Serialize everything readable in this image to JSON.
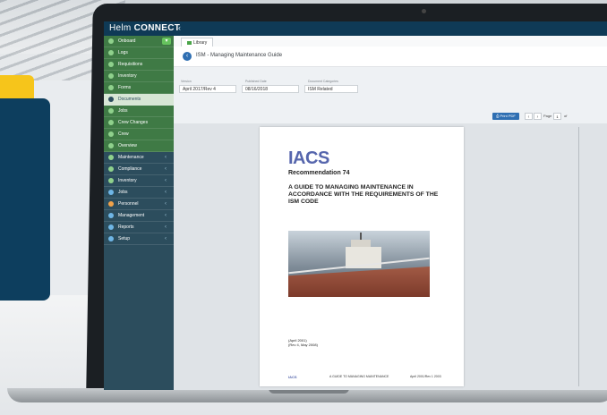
{
  "app": {
    "brand_prefix": "Helm",
    "brand_name": "CONNECT",
    "brand_chevron": "‹"
  },
  "sidebar": {
    "items": [
      {
        "label": "Onboard",
        "chevron": ""
      },
      {
        "label": "Logs",
        "chevron": ""
      },
      {
        "label": "Requisitions",
        "chevron": ""
      },
      {
        "label": "Inventory",
        "chevron": ""
      },
      {
        "label": "Forms",
        "chevron": ""
      },
      {
        "label": "Documents",
        "chevron": ""
      },
      {
        "label": "Jobs",
        "chevron": ""
      },
      {
        "label": "Crew Changes",
        "chevron": ""
      },
      {
        "label": "Crew",
        "chevron": ""
      },
      {
        "label": "Overview",
        "chevron": ""
      },
      {
        "label": "Maintenance",
        "chevron": "‹"
      },
      {
        "label": "Compliance",
        "chevron": "‹"
      },
      {
        "label": "Inventory",
        "chevron": "‹"
      },
      {
        "label": "Jobs",
        "chevron": "‹"
      },
      {
        "label": "Personnel",
        "chevron": "‹"
      },
      {
        "label": "Management",
        "chevron": "‹"
      },
      {
        "label": "Reports",
        "chevron": "‹"
      },
      {
        "label": "Setup",
        "chevron": "‹"
      }
    ]
  },
  "tab": {
    "label": "Library"
  },
  "document": {
    "title": "ISM - Managing Maintenance Guide",
    "fields": {
      "version_label": "Version",
      "version_value": "April 2017/Rev 4",
      "published_label": "Published Date",
      "published_value": "08/16/2018",
      "category_label": "Document Categories",
      "category_value": "ISM Related"
    }
  },
  "toolbar": {
    "print_label": "Print PDF",
    "prev": "‹",
    "next": "›",
    "page_label": "Page",
    "page_value": "1",
    "of_label": "of"
  },
  "pdf": {
    "brand": "IACS",
    "recommendation": "Recommendation 74",
    "heading": "A GUIDE TO MANAGING MAINTENANCE IN ACCORDANCE WITH THE REQUIREMENTS OF THE ISM CODE",
    "date_line1": "(April 2001)",
    "date_line2": "(Rev 4, May 2008)",
    "footer_brand": "IACS",
    "footer_title": "A GUIDE TO MANAGING MAINTENANCE",
    "footer_date": "April 2001/Rev 1 2003"
  }
}
